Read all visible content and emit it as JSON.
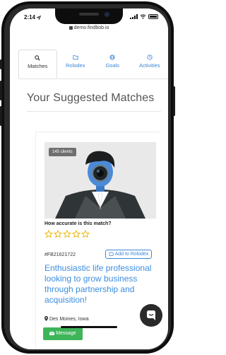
{
  "status_bar": {
    "time": "2:14",
    "location_arrow": "location-arrow-icon"
  },
  "browser": {
    "url": "demo.findbob.io"
  },
  "tabs": [
    {
      "label": "Matches",
      "icon": "search-icon",
      "active": true
    },
    {
      "label": "Rolodex",
      "icon": "folder-icon",
      "active": false
    },
    {
      "label": "Goals",
      "icon": "globe-icon",
      "active": false
    },
    {
      "label": "Activities",
      "icon": "clock-icon",
      "active": false
    }
  ],
  "page": {
    "title": "Your Suggested Matches"
  },
  "match": {
    "clients_badge": "145 clients",
    "accuracy_question": "How accurate is this match?",
    "rating": {
      "max": 5,
      "value": 0
    },
    "id": "#FB21621722",
    "add_button": "Add to Rolodex",
    "headline": "Enthusiastic life professional looking to grow business through partnership and acquisition!",
    "location": "Des Moines, Iowa",
    "message_button": "Message"
  },
  "colors": {
    "accent": "#3b86d8",
    "message_green": "#3fb55a",
    "star_gold": "#e8b400",
    "title_gray": "#555555"
  }
}
